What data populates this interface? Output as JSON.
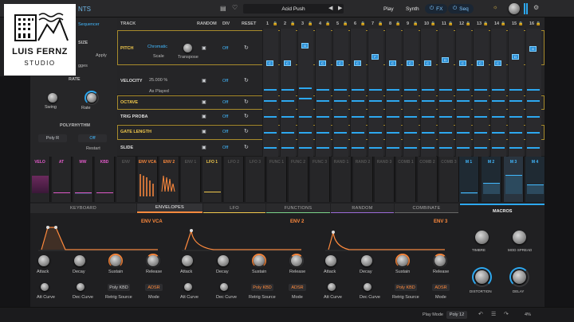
{
  "topbar": {
    "title_fragment": "NTS",
    "seq_tab": "Sequencer",
    "preset": "Acid Push",
    "play": "Play",
    "synth": "Synth",
    "fx": "FX",
    "seq": "Seq"
  },
  "logo": {
    "line1": "LUIS FERNZ",
    "line2": "STUDIO"
  },
  "left": {
    "size_label": "SIZE",
    "apply": "Apply",
    "edges": "gges",
    "rate": "RATE",
    "swing": "Swing",
    "rate_knob": "Rate",
    "polyrhythm": "POLYRHYTHM",
    "poly_r": "Poly R",
    "poly_off": "Off",
    "restart": "Restart"
  },
  "seqhead": {
    "track": "TRACK",
    "random": "RANDOM",
    "div": "DIV",
    "reset": "RESET",
    "steps": [
      "1",
      "2",
      "3",
      "4",
      "5",
      "6",
      "7",
      "8",
      "9",
      "10",
      "11",
      "12",
      "13",
      "14",
      "15",
      "16"
    ]
  },
  "tracks": {
    "pitch": {
      "name": "PITCH",
      "scale_val": "Chromatic",
      "scale": "Scale",
      "transpose": "Transpose",
      "div": "Off"
    },
    "velocity": {
      "name": "VELOCITY",
      "pct": "25.000 %",
      "as_played": "As Played",
      "div": "Off"
    },
    "octave": {
      "name": "OCTAVE",
      "div": "Off"
    },
    "trig": {
      "name": "TRIG PROBA",
      "div": "Off"
    },
    "gate": {
      "name": "GATE LENGTH",
      "div": "Off"
    },
    "slide": {
      "name": "SLIDE",
      "div": "Off"
    }
  },
  "pitch_notes": [
    "C",
    "C",
    "G",
    "C",
    "C",
    "C",
    "F",
    "C",
    "C",
    "C",
    "D",
    "C",
    "C",
    "C",
    "D",
    "G"
  ],
  "mods": [
    "VELO",
    "AT",
    "MW",
    "KBD",
    "ENV",
    "ENV VCA",
    "ENV 2",
    "ENV 1",
    "LFO 1",
    "LFO 2",
    "LFO 3",
    "FUNC 1",
    "FUNC 2",
    "FUNC 3",
    "RAND 1",
    "RAND 2",
    "RAND 3",
    "COMB 1",
    "COMB 2",
    "COMB 3",
    "M 1",
    "M 2",
    "M 3",
    "M 4"
  ],
  "tabs": [
    "KEYBOARD",
    "ENVELOPES",
    "LFO",
    "FUNCTIONS",
    "RANDOM",
    "COMBINATE"
  ],
  "env": {
    "vca": {
      "title": "ENV VCA",
      "attack": "Attack",
      "decay": "Decay",
      "sustain": "Sustain",
      "release": "Release",
      "att_curve": "Att Curve",
      "dec_curve": "Dec Curve",
      "retrig_source": "Retrig Source",
      "mode": "Mode",
      "retrig_val": "Poly KBD",
      "mode_val": "ADSR"
    },
    "env2": {
      "title": "ENV 2",
      "attack": "Attack",
      "decay": "Decay",
      "sustain": "Sustain",
      "release": "Release",
      "att_curve": "Att Curve",
      "dec_curve": "Dec Curve",
      "retrig_source": "Retrig Source",
      "mode": "Mode",
      "retrig_val": "Poly KBD",
      "mode_val": "ADSR"
    },
    "env3": {
      "title": "ENV 3",
      "attack": "Attack",
      "decay": "Decay",
      "sustain": "Sustain",
      "release": "Release",
      "att_curve": "Att Curve",
      "dec_curve": "Dec Curve",
      "retrig_source": "Retrig Source",
      "mode": "Mode",
      "retrig_val": "Poly KBD",
      "mode_val": "ADSR"
    }
  },
  "macros": {
    "title": "MACROS",
    "timbre": "TIMBRE",
    "mod_spread": "MOD SPREAD",
    "distortion": "DISTORTION",
    "delay": "DELAY"
  },
  "bottom": {
    "play_mode": "Play Mode",
    "poly": "Poly 12",
    "zoom": "4%"
  }
}
